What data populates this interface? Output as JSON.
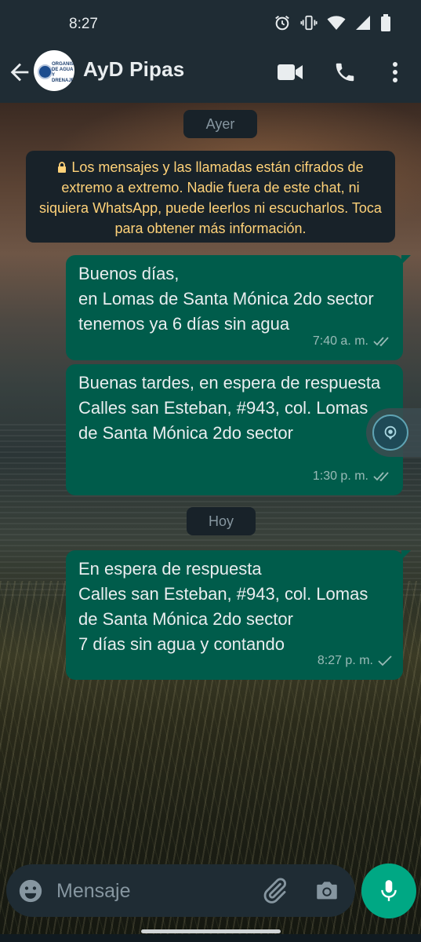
{
  "status_bar": {
    "time": "8:27",
    "icons": [
      "alarm-icon",
      "vibrate-icon",
      "wifi-icon",
      "signal-icon",
      "battery-icon"
    ]
  },
  "header": {
    "title": "AyD Pipas",
    "avatar_text": "ORGANISMO DE AGUA Y DRENAJE",
    "icons": [
      "back-arrow-icon",
      "video-call-icon",
      "voice-call-icon",
      "more-options-icon"
    ]
  },
  "chat": {
    "date_chip_1": "Ayer",
    "encryption_notice": "Los mensajes y las llamadas están cifrados de extremo a extremo. Nadie fuera de este chat, ni siquiera WhatsApp, puede leerlos ni escucharlos. Toca para obtener más información.",
    "messages": [
      {
        "text": "Buenos días,\nen Lomas de Santa Mónica 2do sector tenemos ya 6 días sin agua",
        "time": "7:40 a. m.",
        "status": "read"
      },
      {
        "text": "Buenas tardes, en espera de respuesta\nCalles san Esteban, #943, col. Lomas de Santa Mónica 2do sector",
        "time": "1:30 p. m.",
        "status": "read"
      }
    ],
    "date_chip_2": "Hoy",
    "messages_today": [
      {
        "text": "En espera de respuesta\nCalles san Esteban, #943, col. Lomas de Santa Mónica 2do sector\n7 días sin agua y contando",
        "time": "8:27 p. m.",
        "status": "sent"
      }
    ]
  },
  "composer": {
    "placeholder": "Mensaje",
    "value": ""
  },
  "colors": {
    "header_bg": "#1f2c34",
    "outgoing_bubble": "#005c4b",
    "accent": "#00a884",
    "encryption_text": "#ffd279"
  }
}
